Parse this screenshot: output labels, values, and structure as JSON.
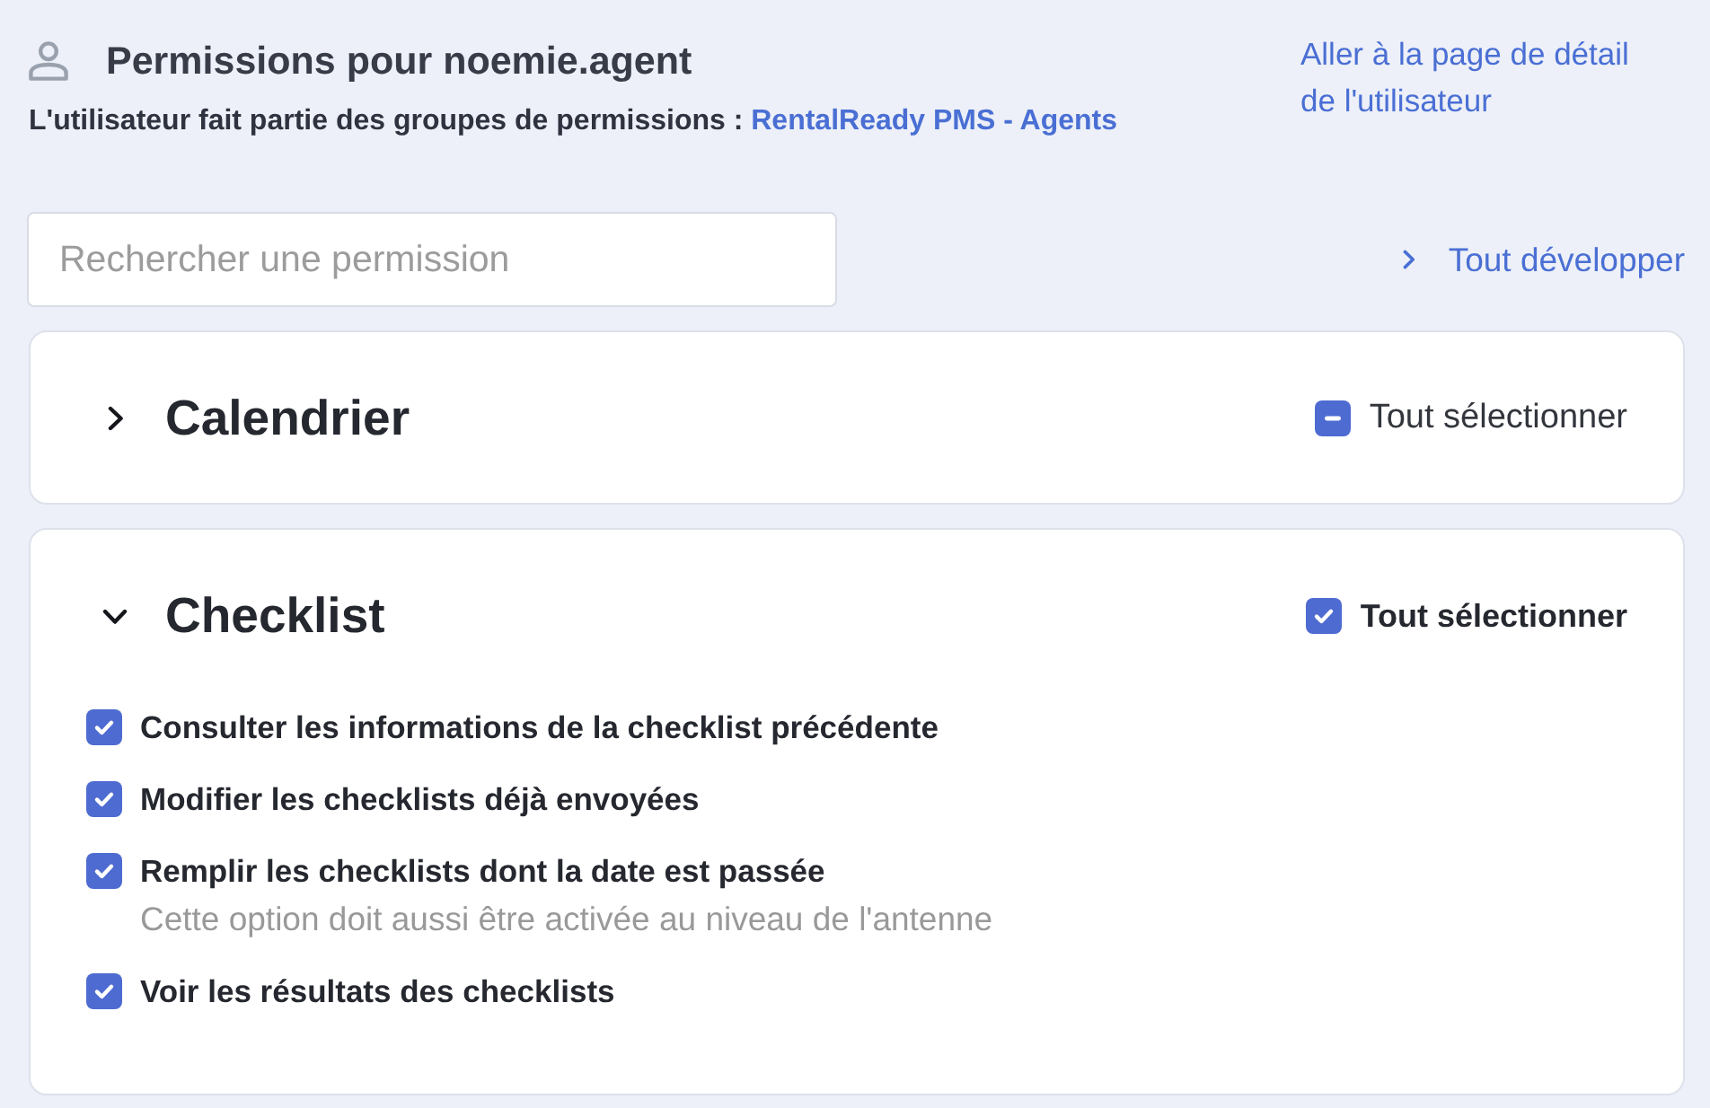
{
  "header": {
    "title": "Permissions pour noemie.agent",
    "groups_label": "L'utilisateur fait partie des groupes de permissions :",
    "groups_link": "RentalReady PMS - Agents",
    "detail_link": "Aller à la page de détail de l'utilisateur"
  },
  "search": {
    "placeholder": "Rechercher une permission"
  },
  "expand_all": {
    "label": "Tout développer"
  },
  "sections": [
    {
      "title": "Calendrier",
      "expanded": false,
      "select_all": {
        "label": "Tout sélectionner",
        "checked": false,
        "indeterminate": true
      }
    },
    {
      "title": "Checklist",
      "expanded": true,
      "select_all": {
        "label": "Tout sélectionner",
        "checked": true,
        "indeterminate": false
      },
      "permissions": [
        {
          "label": "Consulter les informations de la checklist précédente",
          "checked": true
        },
        {
          "label": "Modifier les checklists déjà envoyées",
          "checked": true
        },
        {
          "label": "Remplir les checklists dont la date est passée",
          "checked": true,
          "note": "Cette option doit aussi être activée au niveau de l'antenne"
        },
        {
          "label": "Voir les résultats des checklists",
          "checked": true
        }
      ]
    }
  ]
}
